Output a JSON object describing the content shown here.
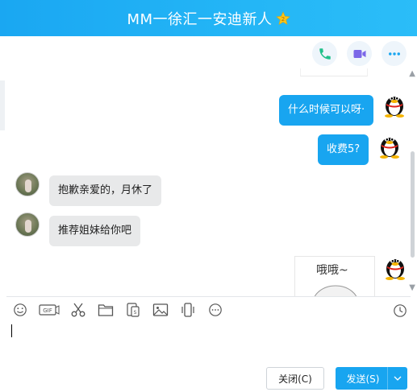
{
  "window": {
    "title": "MM一徐汇一安迪新人",
    "vip_badge": "2"
  },
  "top_actions": [
    {
      "name": "voice-call",
      "icon": "phone-icon",
      "color": "#20c08a"
    },
    {
      "name": "video-call",
      "icon": "video-camera-icon",
      "color": "#7b67e8"
    },
    {
      "name": "more",
      "icon": "more-dots-icon",
      "color": "#18a5f0"
    }
  ],
  "messages": [
    {
      "sender": "me",
      "text": "什么时候可以呀·"
    },
    {
      "sender": "me",
      "text": "收费5?"
    },
    {
      "sender": "other",
      "text": "抱歉亲爱的，月休了"
    },
    {
      "sender": "other",
      "text": "推荐姐妹给你吧"
    },
    {
      "sender": "me",
      "type": "sticker",
      "text": "哦哦~"
    }
  ],
  "toolbar": {
    "items": [
      "emoji-icon",
      "gif-icon",
      "scissors-icon",
      "folder-icon",
      "red-packet-icon",
      "image-icon",
      "shake-icon",
      "more-icon"
    ],
    "history": "clock-icon"
  },
  "input": {
    "value": ""
  },
  "buttons": {
    "close_label": "关闭(C)",
    "send_label": "发送(S)"
  },
  "colors": {
    "accent": "#18a5f0",
    "bubble_other": "#e8e9ea"
  }
}
